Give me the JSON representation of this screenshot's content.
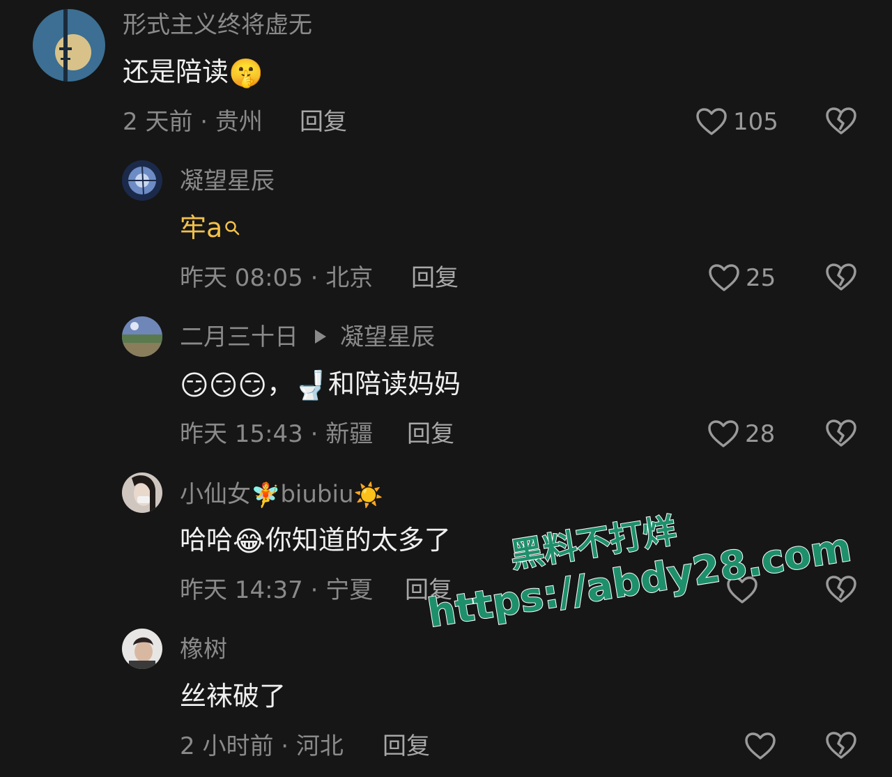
{
  "comments": [
    {
      "username": "形式主义终将虚无",
      "body_text": "还是陪读",
      "body_emoji": "🤫",
      "time_location": "2 天前 · 贵州",
      "reply_label": "回复",
      "like_count": "105"
    },
    {
      "username": "凝望星辰",
      "body_text": "牢a",
      "time_location": "昨天 08:05 · 北京",
      "reply_label": "回复",
      "like_count": "25"
    },
    {
      "username": "二月三十日",
      "reply_to": "凝望星辰",
      "body_emojis": "😏😏😏",
      "body_sep": "，",
      "body_emoji_toilet": "🚽",
      "body_text": "和陪读妈妈",
      "time_location": "昨天 15:43 · 新疆",
      "reply_label": "回复",
      "like_count": "28"
    },
    {
      "username_prefix": "小仙女",
      "username_emoji1": "🧚",
      "username_mid": "biubiu",
      "username_emoji2": "☀️",
      "body_text1": "哈哈",
      "body_emoji": "😂",
      "body_text2": "你知道的太多了",
      "time_location": "昨天 14:37 · 宁夏",
      "reply_label": "回复"
    },
    {
      "username": "橡树",
      "body_text": "丝袜破了",
      "time_location": "2 小时前 · 河北",
      "reply_label": "回复"
    }
  ],
  "watermark": {
    "line1": "黑料不打烊",
    "line2": "https://abdy28.com"
  },
  "icons": {
    "like": "heart-outline-icon",
    "dislike": "broken-heart-icon"
  },
  "colors": {
    "background": "#161616",
    "highlight": "#f2c14b",
    "watermark": "#1e8f6b"
  }
}
